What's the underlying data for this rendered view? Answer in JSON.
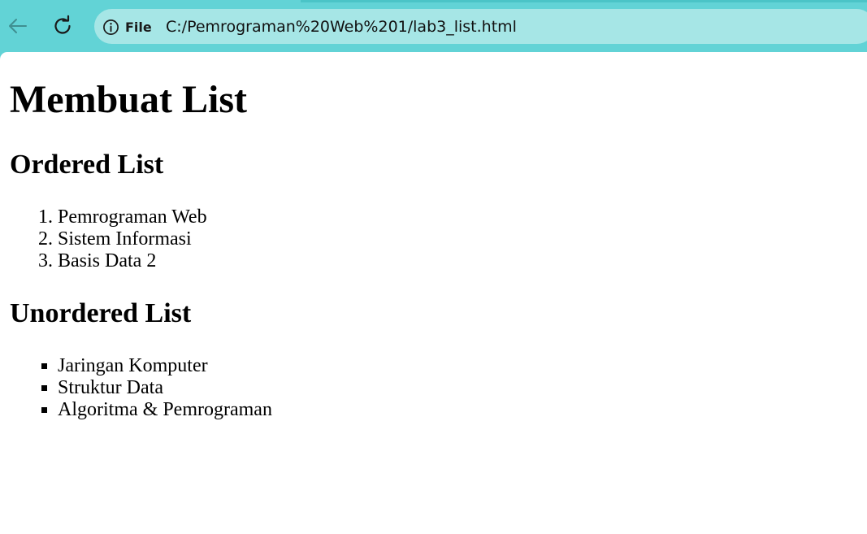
{
  "browser": {
    "scheme_label": "File",
    "url": "C:/Pemrograman%20Web%201/lab3_list.html"
  },
  "page": {
    "title": "Membuat List",
    "ordered_heading": "Ordered List",
    "ordered_items": [
      "Pemrograman Web",
      "Sistem Informasi",
      "Basis Data 2"
    ],
    "unordered_heading": "Unordered List",
    "unordered_items": [
      "Jaringan Komputer",
      "Struktur Data",
      "Algoritma & Pemrograman"
    ]
  },
  "icons": {
    "back": "arrow-left-icon",
    "reload": "reload-icon",
    "site_info": "info-circle-icon"
  },
  "colors": {
    "toolbar": "#62d3d6",
    "address_bar": "#a6e6e6",
    "page_background": "#ffffff",
    "text": "#000000"
  }
}
